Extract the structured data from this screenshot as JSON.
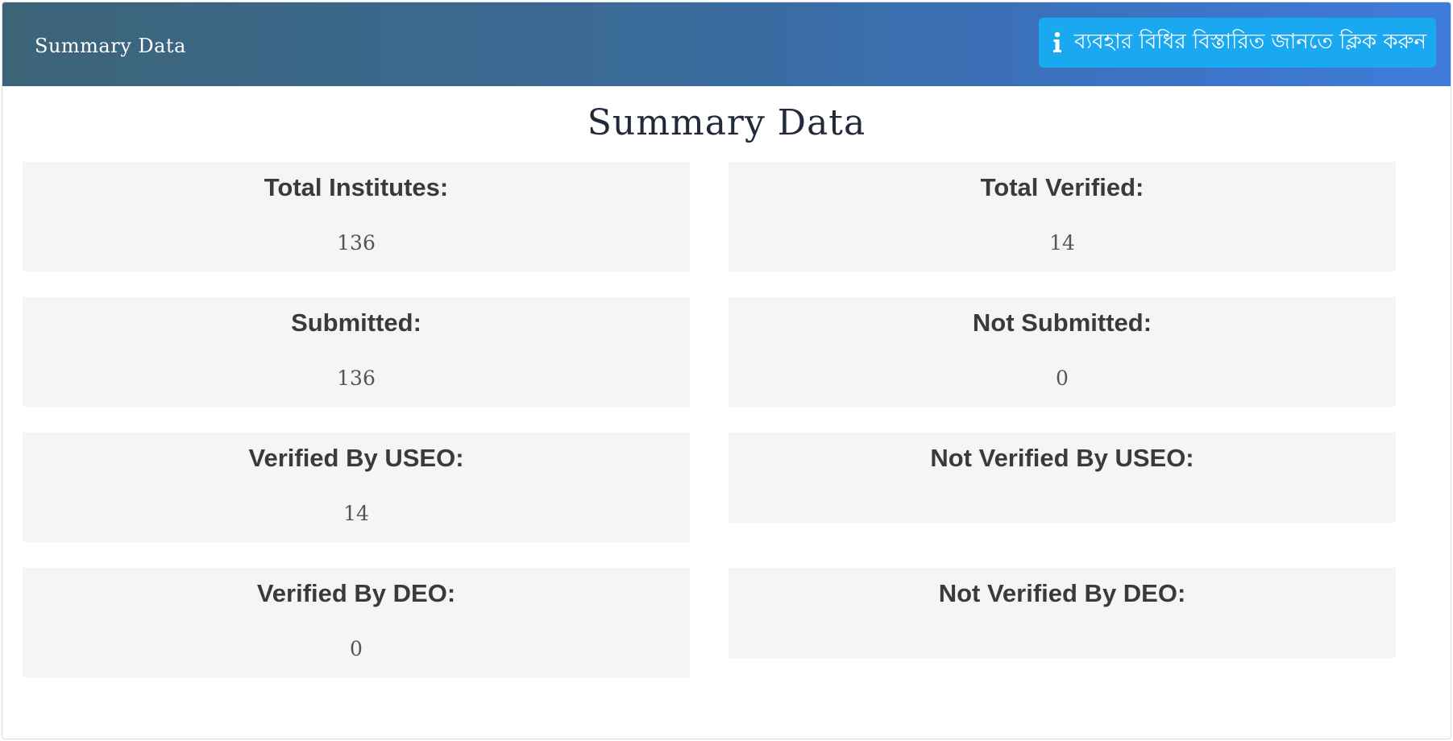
{
  "header": {
    "title": "Summary Data",
    "info_button_label": "ব্যবহার বিধির বিস্তারিত জানতে ক্লিক করুন",
    "info_icon": "info-icon"
  },
  "page": {
    "title": "Summary Data"
  },
  "stats": {
    "total_institutes": {
      "label": "Total Institutes:",
      "value": "136"
    },
    "total_verified": {
      "label": "Total Verified:",
      "value": "14"
    },
    "submitted": {
      "label": "Submitted:",
      "value": "136"
    },
    "not_submitted": {
      "label": "Not Submitted:",
      "value": "0"
    },
    "verified_by_useo": {
      "label": "Verified By USEO:",
      "value": "14"
    },
    "not_verified_by_useo": {
      "label": "Not Verified By USEO:",
      "value": ""
    },
    "verified_by_deo": {
      "label": "Verified By DEO:",
      "value": "0"
    },
    "not_verified_by_deo": {
      "label": "Not Verified By DEO:",
      "value": ""
    }
  },
  "colors": {
    "header_gradient_start": "#3c6478",
    "header_gradient_end": "#3f7cdb",
    "info_button": "#1aa8f0",
    "stat_background": "#f5f5f5",
    "label_text": "#3a3a3a",
    "value_text": "#555555",
    "page_title_text": "#222a3a"
  }
}
